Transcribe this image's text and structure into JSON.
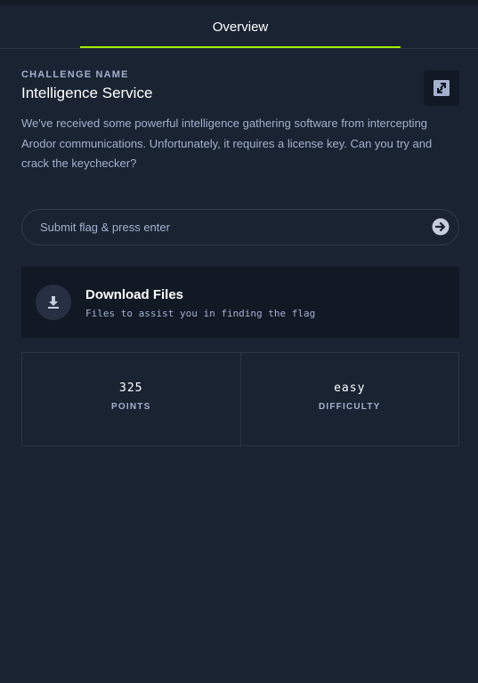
{
  "tabs": [
    {
      "label": "Overview",
      "active": true
    }
  ],
  "challenge": {
    "name_label": "CHALLENGE NAME",
    "name": "Intelligence Service",
    "description": "We've received some powerful intelligence gathering software from intercepting Arodor communications. Unfortunately, it requires a license key. Can you try and crack the keychecker?",
    "share_icon": "share-icon"
  },
  "flag": {
    "placeholder": "Submit flag & press enter",
    "value": "",
    "submit_icon": "arrow-right-circle-icon"
  },
  "download": {
    "title": "Download Files",
    "subtitle": "Files to assist you in finding the flag",
    "icon": "download-icon"
  },
  "stats": [
    {
      "value": "325",
      "label": "POINTS"
    },
    {
      "value": "easy",
      "label": "DIFFICULTY"
    }
  ],
  "colors": {
    "background": "#1a2332",
    "panel": "#111925",
    "accent": "#9fef00",
    "muted_text": "#a4b1cd"
  }
}
